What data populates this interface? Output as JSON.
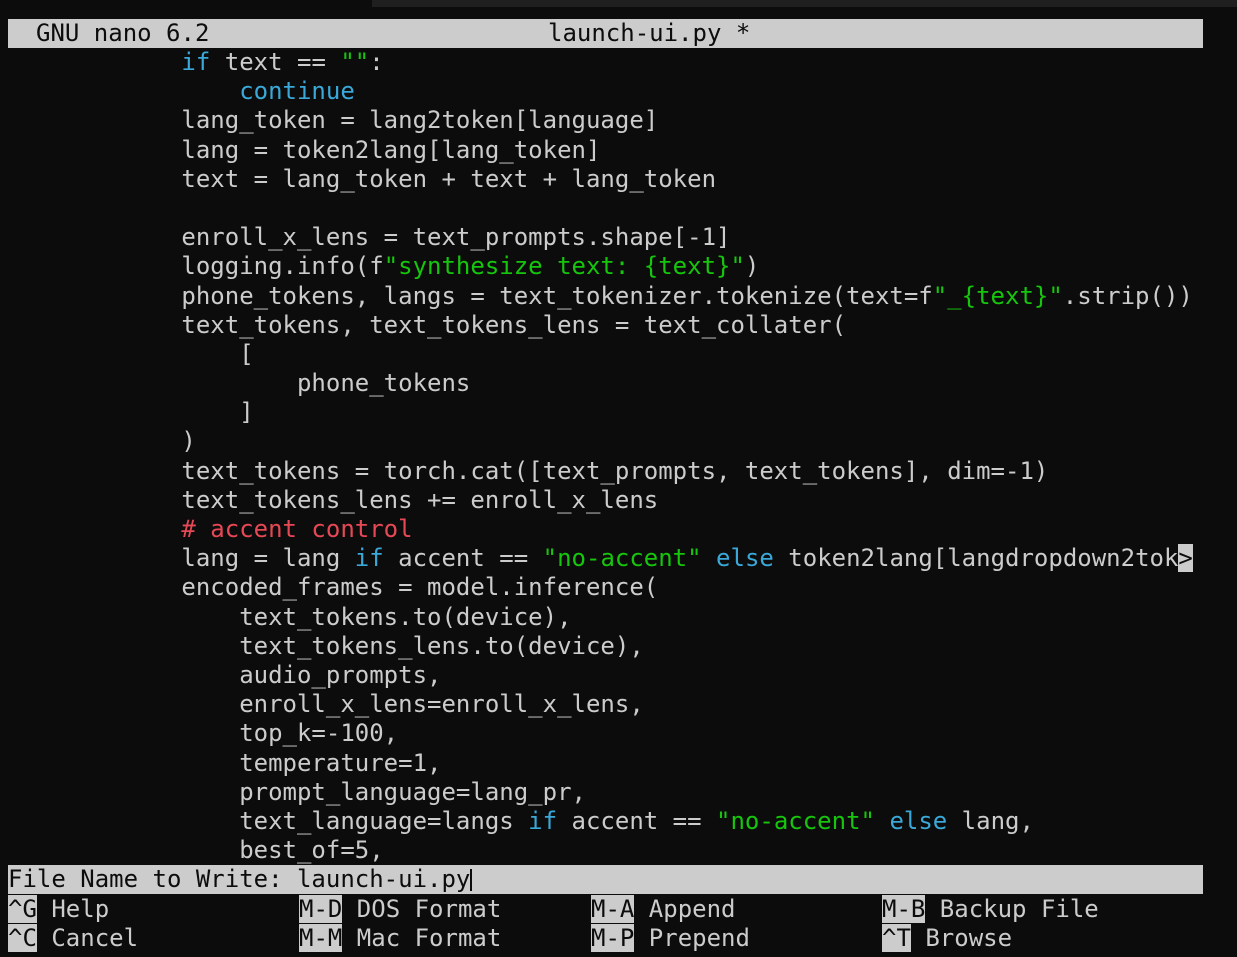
{
  "title_bar": {
    "app_version": "GNU nano 6.2",
    "file_title": "launch-ui.py *"
  },
  "code_lines": [
    [
      [
        "plain",
        "            "
      ],
      [
        "kw",
        "if"
      ],
      [
        "plain",
        " text == "
      ],
      [
        "str",
        "\"\""
      ],
      [
        "plain",
        ":"
      ]
    ],
    [
      [
        "plain",
        "                "
      ],
      [
        "kw",
        "continue"
      ]
    ],
    [
      [
        "plain",
        "            lang_token = lang2token[language]"
      ]
    ],
    [
      [
        "plain",
        "            lang = token2lang[lang_token]"
      ]
    ],
    [
      [
        "plain",
        "            text = lang_token + text + lang_token"
      ]
    ],
    [
      [
        "plain",
        ""
      ]
    ],
    [
      [
        "plain",
        "            enroll_x_lens = text_prompts.shape[-1]"
      ]
    ],
    [
      [
        "plain",
        "            logging.info(f"
      ],
      [
        "str",
        "\"synthesize text: {text}\""
      ],
      [
        "plain",
        ")"
      ]
    ],
    [
      [
        "plain",
        "            phone_tokens, langs = text_tokenizer.tokenize(text=f"
      ],
      [
        "str",
        "\"_{text}\""
      ],
      [
        "plain",
        ".strip())"
      ]
    ],
    [
      [
        "plain",
        "            text_tokens, text_tokens_lens = text_collater("
      ]
    ],
    [
      [
        "plain",
        "                ["
      ]
    ],
    [
      [
        "plain",
        "                    phone_tokens"
      ]
    ],
    [
      [
        "plain",
        "                ]"
      ]
    ],
    [
      [
        "plain",
        "            )"
      ]
    ],
    [
      [
        "plain",
        "            text_tokens = torch.cat([text_prompts, text_tokens], dim=-1)"
      ]
    ],
    [
      [
        "plain",
        "            text_tokens_lens += enroll_x_lens"
      ]
    ],
    [
      [
        "plain",
        "            "
      ],
      [
        "cmt",
        "# accent control"
      ]
    ],
    [
      [
        "plain",
        "            lang = lang "
      ],
      [
        "kw",
        "if"
      ],
      [
        "plain",
        " accent == "
      ],
      [
        "str",
        "\"no-accent\""
      ],
      [
        "plain",
        " "
      ],
      [
        "kw",
        "else"
      ],
      [
        "plain",
        " token2lang[langdropdown2tok"
      ],
      [
        "trunc",
        ">"
      ]
    ],
    [
      [
        "plain",
        "            encoded_frames = model.inference("
      ]
    ],
    [
      [
        "plain",
        "                text_tokens.to(device),"
      ]
    ],
    [
      [
        "plain",
        "                text_tokens_lens.to(device),"
      ]
    ],
    [
      [
        "plain",
        "                audio_prompts,"
      ]
    ],
    [
      [
        "plain",
        "                enroll_x_lens=enroll_x_lens,"
      ]
    ],
    [
      [
        "plain",
        "                top_k=-100,"
      ]
    ],
    [
      [
        "plain",
        "                temperature=1,"
      ]
    ],
    [
      [
        "plain",
        "                prompt_language=lang_pr,"
      ]
    ],
    [
      [
        "plain",
        "                text_language=langs "
      ],
      [
        "kw",
        "if"
      ],
      [
        "plain",
        " accent == "
      ],
      [
        "str",
        "\"no-accent\""
      ],
      [
        "plain",
        " "
      ],
      [
        "kw",
        "else"
      ],
      [
        "plain",
        " lang,"
      ]
    ],
    [
      [
        "plain",
        "                best_of=5,"
      ]
    ]
  ],
  "prompt": {
    "label": "File Name to Write: ",
    "value": "launch-ui.py"
  },
  "shortcuts": {
    "help": {
      "key": "^G",
      "label": " Help"
    },
    "cancel": {
      "key": "^C",
      "label": " Cancel"
    },
    "dos_format": {
      "key": "M-D",
      "label": " DOS Format"
    },
    "mac_format": {
      "key": "M-M",
      "label": " Mac Format"
    },
    "append": {
      "key": "M-A",
      "label": " Append"
    },
    "prepend": {
      "key": "M-P",
      "label": " Prepend"
    },
    "backup_file": {
      "key": "M-B",
      "label": " Backup File"
    },
    "browse": {
      "key": "^T",
      "label": " Browse"
    }
  },
  "colors": {
    "background": "#0c0c0c",
    "foreground": "#cccccc",
    "keyword": "#3aa8d8",
    "string": "#16c60c",
    "comment": "#e74856",
    "bar": "#cccccc"
  }
}
